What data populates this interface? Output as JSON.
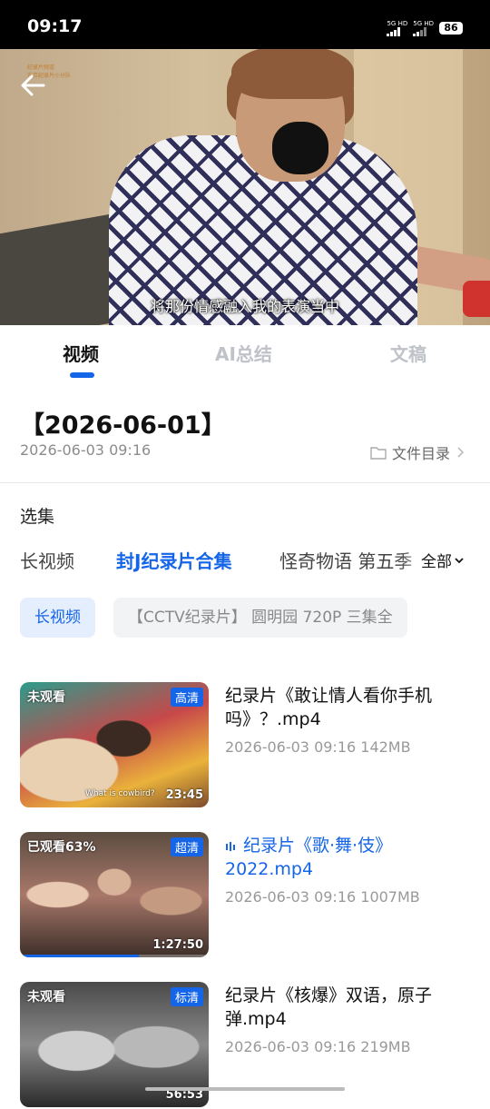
{
  "status_bar": {
    "time": "09:17",
    "network1": "5G HD",
    "network2": "5G HD",
    "battery": "86"
  },
  "video": {
    "subtitle": "将那份情感融入我的表演当中",
    "watermark_line1": "纪录片频道",
    "watermark_line2": "东京纪录片小分队"
  },
  "tabs": [
    {
      "label": "视频",
      "active": true
    },
    {
      "label": "AI总结",
      "active": false
    },
    {
      "label": "文稿",
      "active": false
    }
  ],
  "header": {
    "title": "【2026-06-01】",
    "date": "2026-06-03 09:16",
    "file_dir": "文件目录"
  },
  "episodes": {
    "section_title": "选集",
    "tabs": [
      "长视频",
      "封J纪录片合集",
      "怪奇物语 第五季"
    ],
    "active_index": 1,
    "all_label": "全部",
    "chips": [
      "长视频",
      "【CCTV纪录片】 圆明园 720P 三集全"
    ]
  },
  "items": [
    {
      "title": "纪录片《敢让情人看你手机吗》？.mp4",
      "meta": "2026-06-03 09:16 142MB",
      "watch": "未观看",
      "quality": "高清",
      "duration": "23:45",
      "caption": "What is cowbird?",
      "progress": 0,
      "playing": false
    },
    {
      "title": "纪录片《歌·舞·伎》2022.mp4",
      "meta": "2026-06-03 09:16 1007MB",
      "watch": "已观看63%",
      "quality": "超清",
      "duration": "1:27:50",
      "caption": "",
      "progress": 63,
      "playing": true
    },
    {
      "title": "纪录片《核爆》双语，原子弹.mp4",
      "meta": "2026-06-03 09:16 219MB",
      "watch": "未观看",
      "quality": "标清",
      "duration": "56:53",
      "caption": "",
      "progress": 0,
      "playing": false
    }
  ],
  "colors": {
    "accent": "#1565e8",
    "muted": "#999999"
  }
}
